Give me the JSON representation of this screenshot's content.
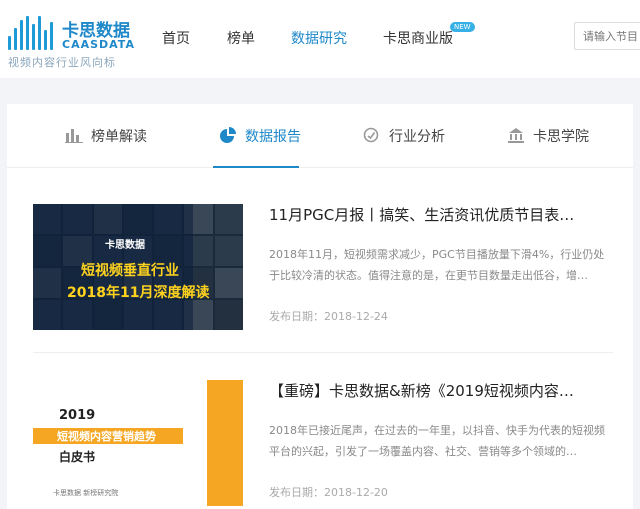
{
  "header": {
    "logo_cn": "卡思数据",
    "logo_en": "CAASDATA",
    "logo_tagline": "视频内容行业风向标",
    "nav": [
      {
        "label": "首页",
        "active": false
      },
      {
        "label": "榜单",
        "active": false
      },
      {
        "label": "数据研究",
        "active": true
      },
      {
        "label": "卡思商业版",
        "active": false
      }
    ],
    "new_badge": "NEW",
    "search_placeholder": "请输入节目",
    "accent_color": "#1e88c9"
  },
  "tabs": [
    {
      "label": "榜单解读",
      "icon": "bar-chart-icon",
      "active": false
    },
    {
      "label": "数据报告",
      "icon": "pie-chart-icon",
      "active": true
    },
    {
      "label": "行业分析",
      "icon": "analysis-icon",
      "active": false
    },
    {
      "label": "卡思学院",
      "icon": "academy-icon",
      "active": false
    }
  ],
  "articles": [
    {
      "title": "11月PGC月报丨搞笑、生活资讯优质节目表…",
      "desc": "2018年11月，短视频需求减少，PGC节目播放量下滑4%，行业仍处于比较冷清的状态。值得注意的是，在更节目数量走出低谷，增…",
      "date": "发布日期：2018-12-24",
      "thumb": {
        "logo": "卡思数据",
        "line1": "短视频垂直行业",
        "line2": "2018年11月深度解读"
      }
    },
    {
      "title": "【重磅】卡思数据&新榜《2019短视频内容…",
      "desc": "2018年已接近尾声，在过去的一年里，以抖音、快手为代表的短视频平台的兴起，引发了一场覆盖内容、社交、营销等多个领域的…",
      "date": "发布日期：2018-12-20",
      "thumb": {
        "year": "2019",
        "bar": "短视频内容营销趋势",
        "sub": "白皮书",
        "footer": "卡思数据      新榜研究院"
      }
    }
  ]
}
